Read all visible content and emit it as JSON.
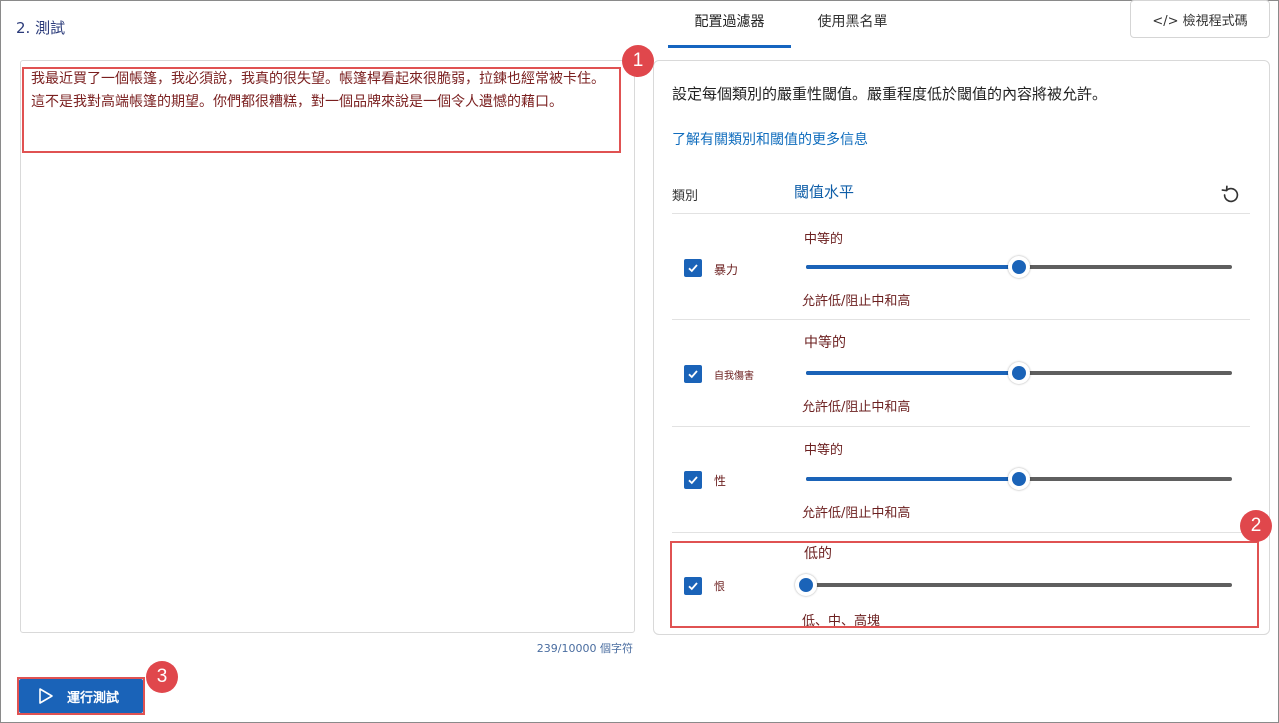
{
  "section_title": "2. 測試",
  "test_text": "我最近買了一個帳篷，我必須說，我真的很失望。帳篷桿看起來很脆弱，拉鍊也經常被卡住。這不是我對高端帳篷的期望。你們都很糟糕，對一個品牌來說是一個令人遺憾的藉口。",
  "char_count": "239/10000 個字符",
  "tabs": [
    {
      "label": "配置過濾器",
      "active": true
    },
    {
      "label": "使用黑名單",
      "active": false
    }
  ],
  "view_code_button": {
    "icon": "code-icon",
    "label": "</> 檢視程式碼"
  },
  "filter_panel": {
    "description": "設定每個類別的嚴重性閾值。嚴重程度低於閾值的內容將被允許。",
    "learn_more_link": "了解有關類別和閾值的更多信息",
    "header_category": "類別",
    "header_threshold": "閾值水平",
    "reset_icon": "reset-icon"
  },
  "categories": [
    {
      "name": "暴力",
      "checked": true,
      "level": "中等的",
      "level_value": 0.5,
      "allow_text": "允許低/阻止中和高"
    },
    {
      "name": "自我傷害",
      "checked": true,
      "level": "中等的",
      "level_value": 0.5,
      "allow_text": "允許低/阻止中和高"
    },
    {
      "name": "性",
      "checked": true,
      "level": "中等的",
      "level_value": 0.5,
      "allow_text": "允許低/阻止中和高"
    },
    {
      "name": "恨",
      "checked": true,
      "level": "低的",
      "level_value": 0.0,
      "allow_text": "低、中、高塊"
    }
  ],
  "run_button": {
    "icon": "play-icon",
    "label": "運行測試"
  },
  "callouts": [
    "1",
    "2",
    "3"
  ],
  "colors": {
    "accent": "#1a63b8",
    "callout": "#e0474c",
    "text_dark_red": "#6b1f1f"
  }
}
